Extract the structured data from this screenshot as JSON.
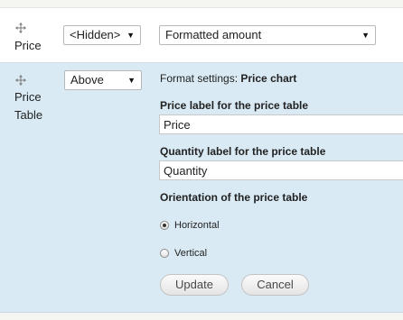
{
  "rows": [
    {
      "label_lines": [
        "Price"
      ],
      "label_select": {
        "value": "<Hidden>"
      },
      "format_select": {
        "value": "Formatted amount"
      }
    },
    {
      "label_lines": [
        "Price",
        "Table"
      ],
      "label_select": {
        "value": "Above"
      }
    }
  ],
  "settings": {
    "title_prefix": "Format settings:",
    "title_name": "Price chart",
    "price_label": {
      "label": "Price label for the price table",
      "value": "Price"
    },
    "quantity_label": {
      "label": "Quantity label for the price table",
      "value": "Quantity"
    },
    "orientation": {
      "label": "Orientation of the price table",
      "options": [
        {
          "label": "Horizontal",
          "checked": true
        },
        {
          "label": "Vertical",
          "checked": false
        }
      ]
    },
    "update_label": "Update",
    "cancel_label": "Cancel"
  },
  "icons": {
    "drag": "drag-handle-icon",
    "dropdown": "chevron-down-icon"
  },
  "colors": {
    "editing_row_bg": "#d9eaf4",
    "button_text": "#4a4a4a"
  }
}
